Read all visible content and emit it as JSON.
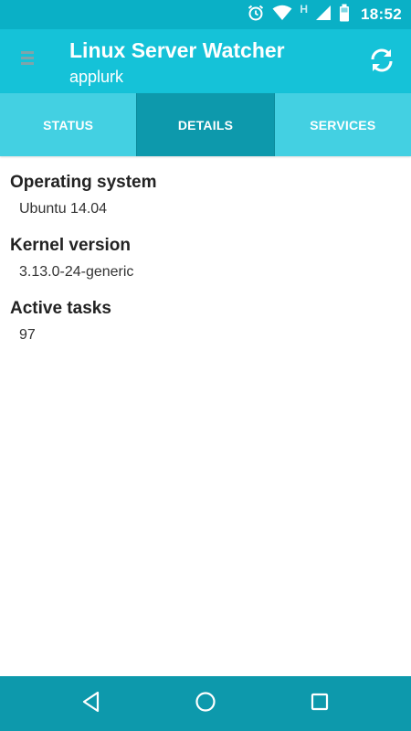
{
  "status_bar": {
    "time": "18:52",
    "network_label": "H",
    "icons": [
      "alarm-icon",
      "wifi-icon",
      "signal-icon",
      "battery-icon"
    ]
  },
  "app_bar": {
    "title": "Linux Server Watcher",
    "subtitle": "applurk",
    "menu_icon": "hamburger-icon",
    "refresh_icon": "refresh-icon"
  },
  "tabs": [
    {
      "label": "STATUS",
      "active": false
    },
    {
      "label": "DETAILS",
      "active": true
    },
    {
      "label": "SERVICES",
      "active": false
    }
  ],
  "details": [
    {
      "label": "Operating system",
      "value": "Ubuntu 14.04"
    },
    {
      "label": "Kernel version",
      "value": "3.13.0-24-generic"
    },
    {
      "label": "Active tasks",
      "value": "97"
    }
  ],
  "nav_bar": {
    "icons": [
      "back-icon",
      "home-icon",
      "recent-apps-icon"
    ]
  },
  "colors": {
    "status_bar": "#0ab0c6",
    "app_bar": "#15c2d8",
    "tab_bar": "#43d0e2",
    "tab_active": "#0d99ac",
    "nav_bar": "#0d99ac"
  }
}
